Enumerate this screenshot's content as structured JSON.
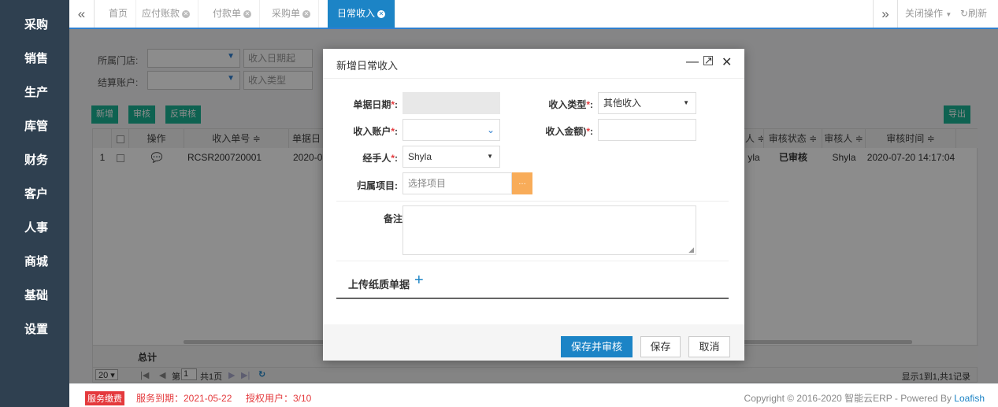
{
  "sidebar": {
    "items": [
      "采购",
      "销售",
      "生产",
      "库管",
      "财务",
      "客户",
      "人事",
      "商城",
      "基础",
      "设置"
    ]
  },
  "topbar": {
    "tabs": [
      {
        "label": "首页",
        "closable": false
      },
      {
        "label": "应付账款",
        "closable": true
      },
      {
        "label": "付款单",
        "closable": true
      },
      {
        "label": "采购单",
        "closable": true
      },
      {
        "label": "日常收入",
        "closable": true,
        "active": true
      }
    ],
    "close_ops_label": "关闭操作",
    "refresh_label": "刷新"
  },
  "filters": {
    "store_label": "所属门店:",
    "date_from_placeholder": "收入日期起",
    "account_label": "结算账户:",
    "income_type_placeholder": "收入类型"
  },
  "toolbar": {
    "add": "新增",
    "audit": "审核",
    "unaudit": "反审核",
    "export": "导出"
  },
  "grid": {
    "headers_left": [
      "操作",
      "收入单号 ≑",
      "单据日"
    ],
    "headers_right": [
      "人 ≑",
      "审核状态 ≑",
      "审核人 ≑",
      "审核时间 ≑"
    ],
    "row": {
      "num": "1",
      "order_no": "RCSR200720001",
      "date": "2020-0",
      "handler": "yla",
      "status": "已审核",
      "auditor": "Shyla",
      "audit_time": "2020-07-20 14:17:04"
    },
    "total_label": "总计"
  },
  "pager": {
    "page_size": "20",
    "page_prefix": "第",
    "page_value": "1",
    "page_total": "共1页",
    "info": "显示1到1,共1记录"
  },
  "footer": {
    "badge": "服务缴费",
    "expiry": "服务到期：2021-05-22",
    "users": "授权用户：3/10",
    "copyright": "Copyright © 2016-2020 智能云ERP - Powered By ",
    "brand": "Loafish"
  },
  "modal": {
    "title": "新增日常收入",
    "date_label": "单据日期",
    "income_type_label": "收入类型",
    "income_type_value": "其他收入",
    "account_label": "收入账户",
    "amount_label": "收入金额)",
    "handler_label": "经手人",
    "handler_value": "Shyla",
    "project_label": "归属项目",
    "project_placeholder": "选择项目",
    "remark_label": "备注:",
    "upload_label": "上传纸质单据",
    "save_audit": "保存并审核",
    "save": "保存",
    "cancel": "取消"
  },
  "colors": {
    "sidebar": "#2f4050",
    "primary": "#1c84c6",
    "success": "#1ab394",
    "warning": "#f8ac59",
    "required": "#e4393c"
  },
  "icons": {
    "collapse": "«",
    "expand": "»",
    "edit": "comment-icon",
    "plus": "+"
  }
}
